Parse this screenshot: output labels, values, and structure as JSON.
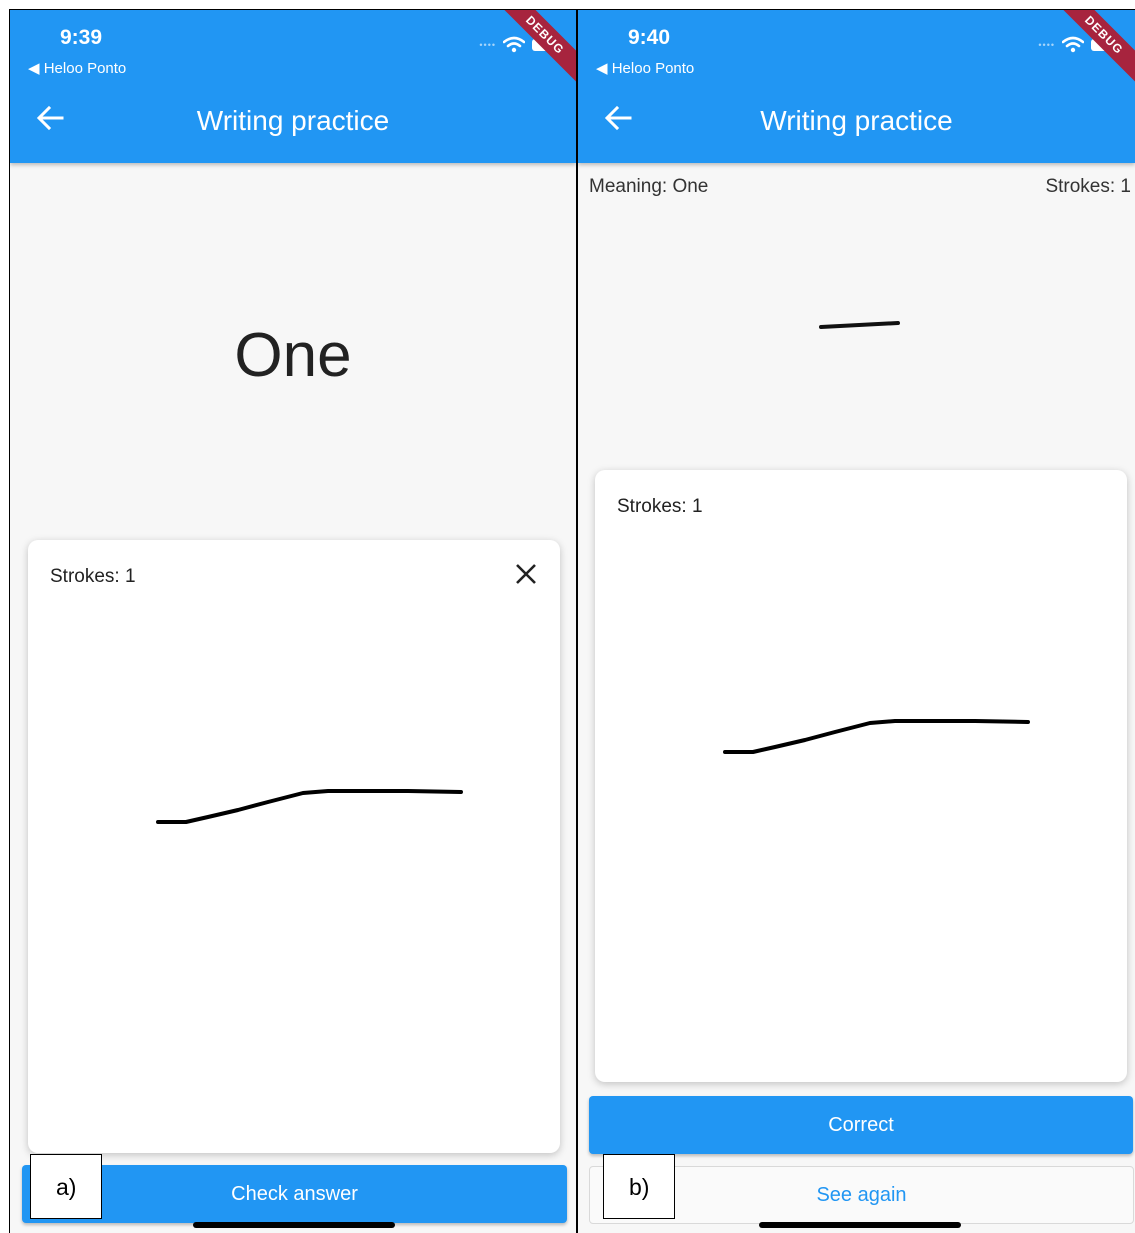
{
  "panels": [
    {
      "label": "a)",
      "status": {
        "time": "9:39",
        "back_app": "Heloo Ponto",
        "debug": "DEBUG"
      },
      "app_bar": {
        "title": "Writing practice"
      },
      "prompt_word": "One",
      "card": {
        "strokes": "Strokes: 1"
      },
      "button": "Check answer"
    },
    {
      "label": "b)",
      "status": {
        "time": "9:40",
        "back_app": "Heloo Ponto",
        "debug": "DEBUG"
      },
      "app_bar": {
        "title": "Writing practice"
      },
      "meaning": "Meaning: One",
      "stroke_count": "Strokes: 1",
      "card": {
        "strokes": "Strokes: 1"
      },
      "buttons": {
        "correct": "Correct",
        "see_again": "See again"
      }
    }
  ],
  "colors": {
    "app_bar": "#2196f3",
    "debug_ribbon": "#a7243e",
    "secondary_text": "#2196f3"
  },
  "icons": {
    "back": "arrow-left-icon",
    "close": "close-icon",
    "wifi": "wifi-icon",
    "battery": "battery-icon",
    "back_app": "triangle-left-icon"
  }
}
